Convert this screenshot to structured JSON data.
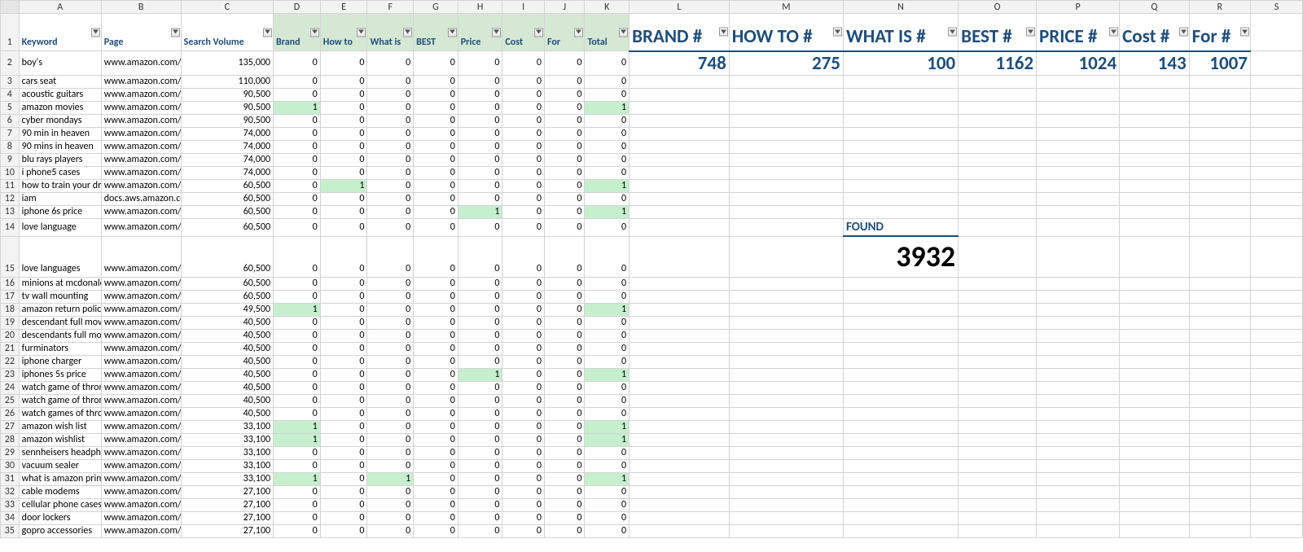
{
  "columns": [
    "A",
    "B",
    "C",
    "D",
    "E",
    "F",
    "G",
    "H",
    "I",
    "J",
    "K",
    "L",
    "M",
    "N",
    "O",
    "P",
    "Q",
    "R",
    "S"
  ],
  "header": {
    "A": "Keyword",
    "B": "Page",
    "C": "Search Volume",
    "D": "Brand",
    "E": "How to",
    "F": "What is",
    "G": "BEST",
    "H": "Price",
    "I": "Cost",
    "J": "For",
    "K": "Total",
    "L": "BRAND #",
    "M": "HOW TO #",
    "N": "WHAT IS #",
    "O": "BEST #",
    "P": "PRICE #",
    "Q": "Cost #",
    "R": "For #"
  },
  "summary": {
    "L": "748",
    "M": "275",
    "N": "100",
    "O": "1162",
    "P": "1024",
    "Q": "143",
    "R": "1007"
  },
  "found": {
    "label": "FOUND",
    "value": "3932"
  },
  "rows": [
    {
      "n": 2,
      "kw": "boy's",
      "pg": "www.amazon.com/l",
      "sv": "135,000",
      "d": "0",
      "e": "0",
      "f": "0",
      "g": "0",
      "h": "0",
      "i": "0",
      "j": "0",
      "t": "0"
    },
    {
      "n": 3,
      "kw": "cars seat",
      "pg": "www.amazon.com/l",
      "sv": "110,000",
      "d": "0",
      "e": "0",
      "f": "0",
      "g": "0",
      "h": "0",
      "i": "0",
      "j": "0",
      "t": "0"
    },
    {
      "n": 4,
      "kw": "acoustic guitars",
      "pg": "www.amazon.com/A",
      "sv": "90,500",
      "d": "0",
      "e": "0",
      "f": "0",
      "g": "0",
      "h": "0",
      "i": "0",
      "j": "0",
      "t": "0"
    },
    {
      "n": 5,
      "kw": "amazon movies",
      "pg": "www.amazon.com/l",
      "sv": "90,500",
      "d": "1",
      "e": "0",
      "f": "0",
      "g": "0",
      "h": "0",
      "i": "0",
      "j": "0",
      "t": "1",
      "hld": true,
      "hlt": true
    },
    {
      "n": 6,
      "kw": "cyber mondays",
      "pg": "www.amazon.com/c",
      "sv": "90,500",
      "d": "0",
      "e": "0",
      "f": "0",
      "g": "0",
      "h": "0",
      "i": "0",
      "j": "0",
      "t": "0"
    },
    {
      "n": 7,
      "kw": "90 min in heaven",
      "pg": "www.amazon.com/S",
      "sv": "74,000",
      "d": "0",
      "e": "0",
      "f": "0",
      "g": "0",
      "h": "0",
      "i": "0",
      "j": "0",
      "t": "0"
    },
    {
      "n": 8,
      "kw": "90 mins in heaven",
      "pg": "www.amazon.com/S",
      "sv": "74,000",
      "d": "0",
      "e": "0",
      "f": "0",
      "g": "0",
      "h": "0",
      "i": "0",
      "j": "0",
      "t": "0"
    },
    {
      "n": 9,
      "kw": "blu rays players",
      "pg": "www.amazon.com/l",
      "sv": "74,000",
      "d": "0",
      "e": "0",
      "f": "0",
      "g": "0",
      "h": "0",
      "i": "0",
      "j": "0",
      "t": "0"
    },
    {
      "n": 10,
      "kw": "i phone5 cases",
      "pg": "www.amazon.com/l",
      "sv": "74,000",
      "d": "0",
      "e": "0",
      "f": "0",
      "g": "0",
      "h": "0",
      "i": "0",
      "j": "0",
      "t": "0"
    },
    {
      "n": 11,
      "kw": "how to train your dragon",
      "pg": "www.amazon.com/l",
      "sv": "60,500",
      "d": "0",
      "e": "1",
      "f": "0",
      "g": "0",
      "h": "0",
      "i": "0",
      "j": "0",
      "t": "1",
      "hle": true,
      "hlt": true
    },
    {
      "n": 12,
      "kw": "iam",
      "pg": "docs.aws.amazon.co",
      "sv": "60,500",
      "d": "0",
      "e": "0",
      "f": "0",
      "g": "0",
      "h": "0",
      "i": "0",
      "j": "0",
      "t": "0"
    },
    {
      "n": 13,
      "kw": "iphone 6s price",
      "pg": "www.amazon.com/A",
      "sv": "60,500",
      "d": "0",
      "e": "0",
      "f": "0",
      "g": "0",
      "h": "1",
      "i": "0",
      "j": "0",
      "t": "1",
      "hlh": true,
      "hlt": true
    },
    {
      "n": 14,
      "kw": "love language",
      "pg": "www.amazon.com/l",
      "sv": "60,500",
      "d": "0",
      "e": "0",
      "f": "0",
      "g": "0",
      "h": "0",
      "i": "0",
      "j": "0",
      "t": "0"
    },
    {
      "n": 15,
      "kw": "love languages",
      "pg": "www.amazon.com/l",
      "sv": "60,500",
      "d": "0",
      "e": "0",
      "f": "0",
      "g": "0",
      "h": "0",
      "i": "0",
      "j": "0",
      "t": "0"
    },
    {
      "n": 16,
      "kw": "minions at mcdonalds",
      "pg": "www.amazon.com/z",
      "sv": "60,500",
      "d": "0",
      "e": "0",
      "f": "0",
      "g": "0",
      "h": "0",
      "i": "0",
      "j": "0",
      "t": "0"
    },
    {
      "n": 17,
      "kw": "tv wall mounting",
      "pg": "www.amazon.com/l",
      "sv": "60,500",
      "d": "0",
      "e": "0",
      "f": "0",
      "g": "0",
      "h": "0",
      "i": "0",
      "j": "0",
      "t": "0"
    },
    {
      "n": 18,
      "kw": "amazon return policy",
      "pg": "www.amazon.com/r",
      "sv": "49,500",
      "d": "1",
      "e": "0",
      "f": "0",
      "g": "0",
      "h": "0",
      "i": "0",
      "j": "0",
      "t": "1",
      "hld": true,
      "hlt": true
    },
    {
      "n": 19,
      "kw": "descendant full movie",
      "pg": "www.amazon.com/c",
      "sv": "40,500",
      "d": "0",
      "e": "0",
      "f": "0",
      "g": "0",
      "h": "0",
      "i": "0",
      "j": "0",
      "t": "0"
    },
    {
      "n": 20,
      "kw": "descendants full movie",
      "pg": "www.amazon.com/c",
      "sv": "40,500",
      "d": "0",
      "e": "0",
      "f": "0",
      "g": "0",
      "h": "0",
      "i": "0",
      "j": "0",
      "t": "0"
    },
    {
      "n": 21,
      "kw": "furminators",
      "pg": "www.amazon.com/l",
      "sv": "40,500",
      "d": "0",
      "e": "0",
      "f": "0",
      "g": "0",
      "h": "0",
      "i": "0",
      "j": "0",
      "t": "0"
    },
    {
      "n": 22,
      "kw": "iphone charger",
      "pg": "www.amazon.com/l",
      "sv": "40,500",
      "d": "0",
      "e": "0",
      "f": "0",
      "g": "0",
      "h": "0",
      "i": "0",
      "j": "0",
      "t": "0"
    },
    {
      "n": 23,
      "kw": "iphones 5s price",
      "pg": "www.amazon.com/A",
      "sv": "40,500",
      "d": "0",
      "e": "0",
      "f": "0",
      "g": "0",
      "h": "1",
      "i": "0",
      "j": "0",
      "t": "1",
      "hlh": true,
      "hlt": true
    },
    {
      "n": 24,
      "kw": "watch game of thrones",
      "pg": "www.amazon.com/c",
      "sv": "40,500",
      "d": "0",
      "e": "0",
      "f": "0",
      "g": "0",
      "h": "0",
      "i": "0",
      "j": "0",
      "t": "0"
    },
    {
      "n": 25,
      "kw": "watch game of thrones",
      "pg": "www.amazon.com/c",
      "sv": "40,500",
      "d": "0",
      "e": "0",
      "f": "0",
      "g": "0",
      "h": "0",
      "i": "0",
      "j": "0",
      "t": "0"
    },
    {
      "n": 26,
      "kw": "watch games of thrones",
      "pg": "www.amazon.com/c",
      "sv": "40,500",
      "d": "0",
      "e": "0",
      "f": "0",
      "g": "0",
      "h": "0",
      "i": "0",
      "j": "0",
      "t": "0"
    },
    {
      "n": 27,
      "kw": "amazon wish list",
      "pg": "www.amazon.com/w",
      "sv": "33,100",
      "d": "1",
      "e": "0",
      "f": "0",
      "g": "0",
      "h": "0",
      "i": "0",
      "j": "0",
      "t": "1",
      "hld": true,
      "hlt": true
    },
    {
      "n": 28,
      "kw": "amazon wishlist",
      "pg": "www.amazon.com/w",
      "sv": "33,100",
      "d": "1",
      "e": "0",
      "f": "0",
      "g": "0",
      "h": "0",
      "i": "0",
      "j": "0",
      "t": "1",
      "hld": true,
      "hlt": true
    },
    {
      "n": 29,
      "kw": "sennheisers headphones",
      "pg": "www.amazon.com/S",
      "sv": "33,100",
      "d": "0",
      "e": "0",
      "f": "0",
      "g": "0",
      "h": "0",
      "i": "0",
      "j": "0",
      "t": "0"
    },
    {
      "n": 30,
      "kw": "vacuum sealer",
      "pg": "www.amazon.com/V",
      "sv": "33,100",
      "d": "0",
      "e": "0",
      "f": "0",
      "g": "0",
      "h": "0",
      "i": "0",
      "j": "0",
      "t": "0"
    },
    {
      "n": 31,
      "kw": "what is amazon prime",
      "pg": "www.amazon.com/p",
      "sv": "33,100",
      "d": "1",
      "e": "0",
      "f": "1",
      "g": "0",
      "h": "0",
      "i": "0",
      "j": "0",
      "t": "1",
      "hld": true,
      "hlf": true,
      "hlt": true
    },
    {
      "n": 32,
      "kw": "cable modems",
      "pg": "www.amazon.com/S",
      "sv": "27,100",
      "d": "0",
      "e": "0",
      "f": "0",
      "g": "0",
      "h": "0",
      "i": "0",
      "j": "0",
      "t": "0"
    },
    {
      "n": 33,
      "kw": "cellular phone cases",
      "pg": "www.amazon.com/c",
      "sv": "27,100",
      "d": "0",
      "e": "0",
      "f": "0",
      "g": "0",
      "h": "0",
      "i": "0",
      "j": "0",
      "t": "0"
    },
    {
      "n": 34,
      "kw": "door lockers",
      "pg": "www.amazon.com/l",
      "sv": "27,100",
      "d": "0",
      "e": "0",
      "f": "0",
      "g": "0",
      "h": "0",
      "i": "0",
      "j": "0",
      "t": "0"
    },
    {
      "n": 35,
      "kw": "gopro accessories",
      "pg": "www.amazon.com/A",
      "sv": "27,100",
      "d": "0",
      "e": "0",
      "f": "0",
      "g": "0",
      "h": "0",
      "i": "0",
      "j": "0",
      "t": "0"
    }
  ]
}
